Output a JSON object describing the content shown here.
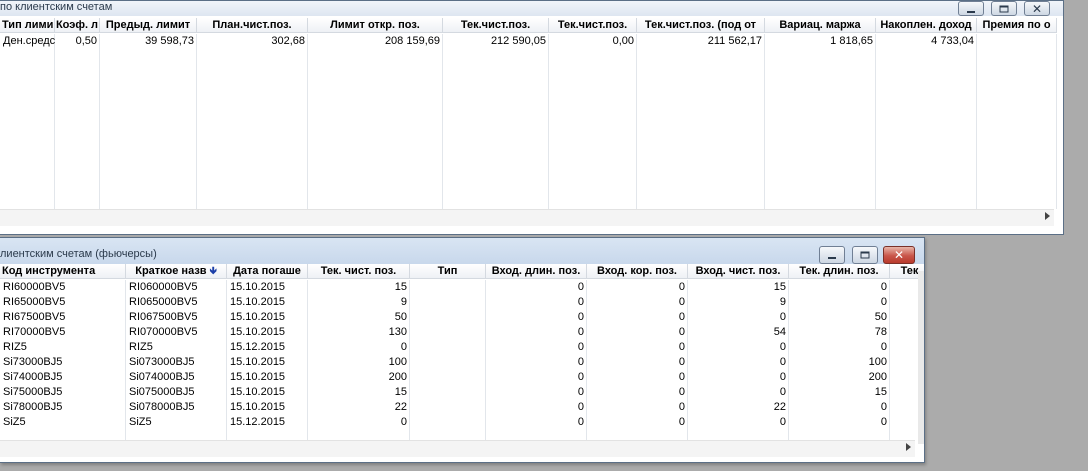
{
  "win1": {
    "title": "по клиентским счетам",
    "columns": [
      "Тип лими",
      "Коэф. л",
      "Предыд. лимит",
      "План.чист.поз.",
      "Лимит откр. поз.",
      "Тек.чист.поз.",
      "Тек.чист.поз.",
      "Тек.чист.поз. (под от",
      "Вариац. маржа",
      "Накоплен. доход",
      "Премия по о"
    ],
    "row": [
      "Ден.средст",
      "0,50",
      "39 598,73",
      "302,68",
      "208 159,69",
      "212 590,05",
      "0,00",
      "211 562,17",
      "1 818,65",
      "4 733,04",
      ""
    ]
  },
  "win2": {
    "title": "лиентским счетам (фьючерсы)",
    "columns": [
      "Код инструмента",
      "Краткое назв",
      "Дата погаше",
      "Тек. чист. поз.",
      "Тип",
      "Вход. длин. поз.",
      "Вход. кор. поз.",
      "Вход. чист. поз.",
      "Тек. длин. поз.",
      "Тек"
    ],
    "rows": [
      [
        "RI60000BV5",
        "RI060000BV5",
        "15.10.2015",
        "15",
        "",
        "0",
        "0",
        "15",
        "0"
      ],
      [
        "RI65000BV5",
        "RI065000BV5",
        "15.10.2015",
        "9",
        "",
        "0",
        "0",
        "9",
        "0"
      ],
      [
        "RI67500BV5",
        "RI067500BV5",
        "15.10.2015",
        "50",
        "",
        "0",
        "0",
        "0",
        "50"
      ],
      [
        "RI70000BV5",
        "RI070000BV5",
        "15.10.2015",
        "130",
        "",
        "0",
        "0",
        "54",
        "78"
      ],
      [
        "RIZ5",
        "RIZ5",
        "15.12.2015",
        "0",
        "",
        "0",
        "0",
        "0",
        "0"
      ],
      [
        "Si73000BJ5",
        "Si073000BJ5",
        "15.10.2015",
        "100",
        "",
        "0",
        "0",
        "0",
        "100"
      ],
      [
        "Si74000BJ5",
        "Si074000BJ5",
        "15.10.2015",
        "200",
        "",
        "0",
        "0",
        "0",
        "200"
      ],
      [
        "Si75000BJ5",
        "Si075000BJ5",
        "15.10.2015",
        "15",
        "",
        "0",
        "0",
        "0",
        "15"
      ],
      [
        "Si78000BJ5",
        "Si078000BJ5",
        "15.10.2015",
        "22",
        "",
        "0",
        "0",
        "22",
        "0"
      ],
      [
        "SiZ5",
        "SiZ5",
        "15.12.2015",
        "0",
        "",
        "0",
        "0",
        "0",
        "0"
      ]
    ]
  },
  "icons": {
    "minimize": "minimize-icon",
    "maximize": "maximize-icon",
    "close": "close-icon"
  },
  "colors": {
    "close_button": "#c9564a",
    "titlebar": "#d9e5f3",
    "desktop": "#ababab"
  }
}
